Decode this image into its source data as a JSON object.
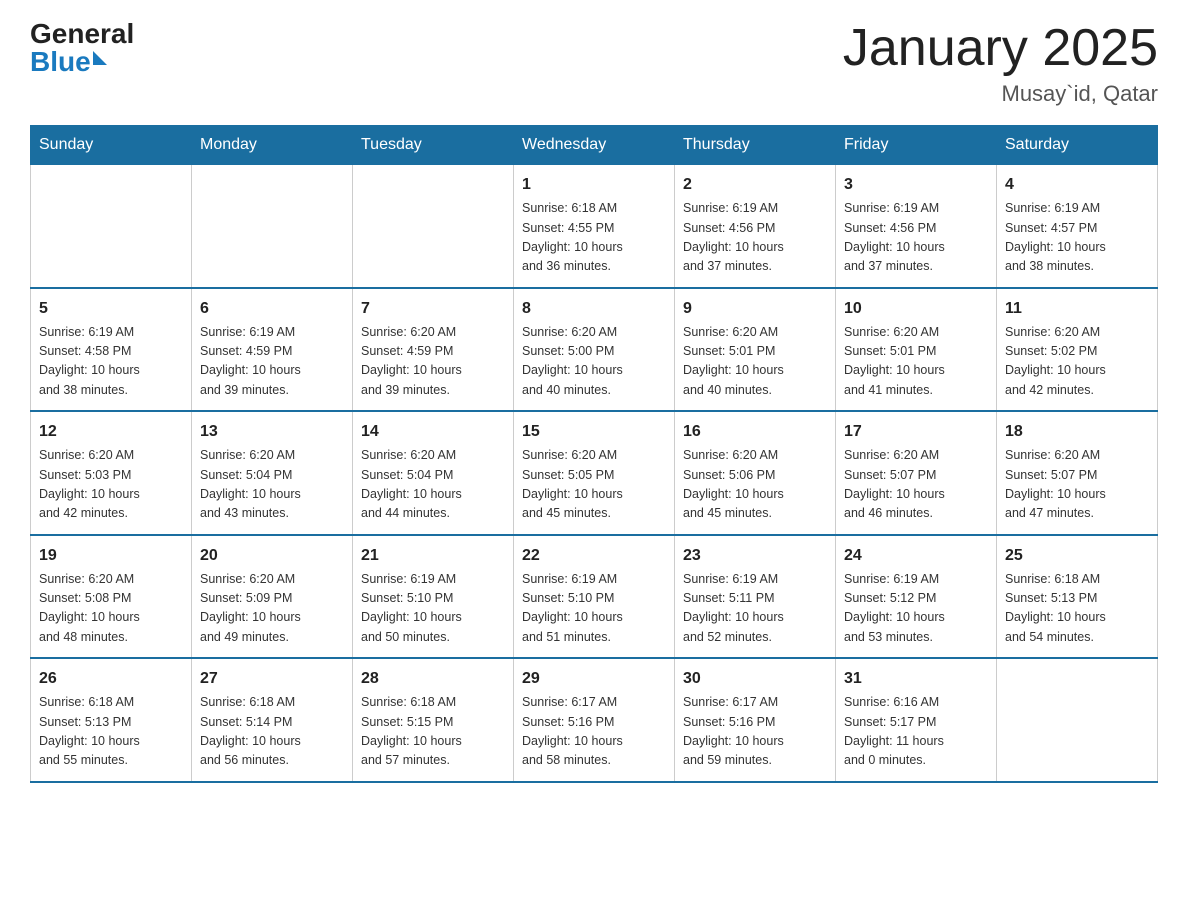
{
  "logo": {
    "general": "General",
    "blue": "Blue"
  },
  "title": {
    "month": "January 2025",
    "location": "Musay`id, Qatar"
  },
  "days_of_week": [
    "Sunday",
    "Monday",
    "Tuesday",
    "Wednesday",
    "Thursday",
    "Friday",
    "Saturday"
  ],
  "weeks": [
    [
      {
        "day": "",
        "info": ""
      },
      {
        "day": "",
        "info": ""
      },
      {
        "day": "",
        "info": ""
      },
      {
        "day": "1",
        "info": "Sunrise: 6:18 AM\nSunset: 4:55 PM\nDaylight: 10 hours\nand 36 minutes."
      },
      {
        "day": "2",
        "info": "Sunrise: 6:19 AM\nSunset: 4:56 PM\nDaylight: 10 hours\nand 37 minutes."
      },
      {
        "day": "3",
        "info": "Sunrise: 6:19 AM\nSunset: 4:56 PM\nDaylight: 10 hours\nand 37 minutes."
      },
      {
        "day": "4",
        "info": "Sunrise: 6:19 AM\nSunset: 4:57 PM\nDaylight: 10 hours\nand 38 minutes."
      }
    ],
    [
      {
        "day": "5",
        "info": "Sunrise: 6:19 AM\nSunset: 4:58 PM\nDaylight: 10 hours\nand 38 minutes."
      },
      {
        "day": "6",
        "info": "Sunrise: 6:19 AM\nSunset: 4:59 PM\nDaylight: 10 hours\nand 39 minutes."
      },
      {
        "day": "7",
        "info": "Sunrise: 6:20 AM\nSunset: 4:59 PM\nDaylight: 10 hours\nand 39 minutes."
      },
      {
        "day": "8",
        "info": "Sunrise: 6:20 AM\nSunset: 5:00 PM\nDaylight: 10 hours\nand 40 minutes."
      },
      {
        "day": "9",
        "info": "Sunrise: 6:20 AM\nSunset: 5:01 PM\nDaylight: 10 hours\nand 40 minutes."
      },
      {
        "day": "10",
        "info": "Sunrise: 6:20 AM\nSunset: 5:01 PM\nDaylight: 10 hours\nand 41 minutes."
      },
      {
        "day": "11",
        "info": "Sunrise: 6:20 AM\nSunset: 5:02 PM\nDaylight: 10 hours\nand 42 minutes."
      }
    ],
    [
      {
        "day": "12",
        "info": "Sunrise: 6:20 AM\nSunset: 5:03 PM\nDaylight: 10 hours\nand 42 minutes."
      },
      {
        "day": "13",
        "info": "Sunrise: 6:20 AM\nSunset: 5:04 PM\nDaylight: 10 hours\nand 43 minutes."
      },
      {
        "day": "14",
        "info": "Sunrise: 6:20 AM\nSunset: 5:04 PM\nDaylight: 10 hours\nand 44 minutes."
      },
      {
        "day": "15",
        "info": "Sunrise: 6:20 AM\nSunset: 5:05 PM\nDaylight: 10 hours\nand 45 minutes."
      },
      {
        "day": "16",
        "info": "Sunrise: 6:20 AM\nSunset: 5:06 PM\nDaylight: 10 hours\nand 45 minutes."
      },
      {
        "day": "17",
        "info": "Sunrise: 6:20 AM\nSunset: 5:07 PM\nDaylight: 10 hours\nand 46 minutes."
      },
      {
        "day": "18",
        "info": "Sunrise: 6:20 AM\nSunset: 5:07 PM\nDaylight: 10 hours\nand 47 minutes."
      }
    ],
    [
      {
        "day": "19",
        "info": "Sunrise: 6:20 AM\nSunset: 5:08 PM\nDaylight: 10 hours\nand 48 minutes."
      },
      {
        "day": "20",
        "info": "Sunrise: 6:20 AM\nSunset: 5:09 PM\nDaylight: 10 hours\nand 49 minutes."
      },
      {
        "day": "21",
        "info": "Sunrise: 6:19 AM\nSunset: 5:10 PM\nDaylight: 10 hours\nand 50 minutes."
      },
      {
        "day": "22",
        "info": "Sunrise: 6:19 AM\nSunset: 5:10 PM\nDaylight: 10 hours\nand 51 minutes."
      },
      {
        "day": "23",
        "info": "Sunrise: 6:19 AM\nSunset: 5:11 PM\nDaylight: 10 hours\nand 52 minutes."
      },
      {
        "day": "24",
        "info": "Sunrise: 6:19 AM\nSunset: 5:12 PM\nDaylight: 10 hours\nand 53 minutes."
      },
      {
        "day": "25",
        "info": "Sunrise: 6:18 AM\nSunset: 5:13 PM\nDaylight: 10 hours\nand 54 minutes."
      }
    ],
    [
      {
        "day": "26",
        "info": "Sunrise: 6:18 AM\nSunset: 5:13 PM\nDaylight: 10 hours\nand 55 minutes."
      },
      {
        "day": "27",
        "info": "Sunrise: 6:18 AM\nSunset: 5:14 PM\nDaylight: 10 hours\nand 56 minutes."
      },
      {
        "day": "28",
        "info": "Sunrise: 6:18 AM\nSunset: 5:15 PM\nDaylight: 10 hours\nand 57 minutes."
      },
      {
        "day": "29",
        "info": "Sunrise: 6:17 AM\nSunset: 5:16 PM\nDaylight: 10 hours\nand 58 minutes."
      },
      {
        "day": "30",
        "info": "Sunrise: 6:17 AM\nSunset: 5:16 PM\nDaylight: 10 hours\nand 59 minutes."
      },
      {
        "day": "31",
        "info": "Sunrise: 6:16 AM\nSunset: 5:17 PM\nDaylight: 11 hours\nand 0 minutes."
      },
      {
        "day": "",
        "info": ""
      }
    ]
  ]
}
